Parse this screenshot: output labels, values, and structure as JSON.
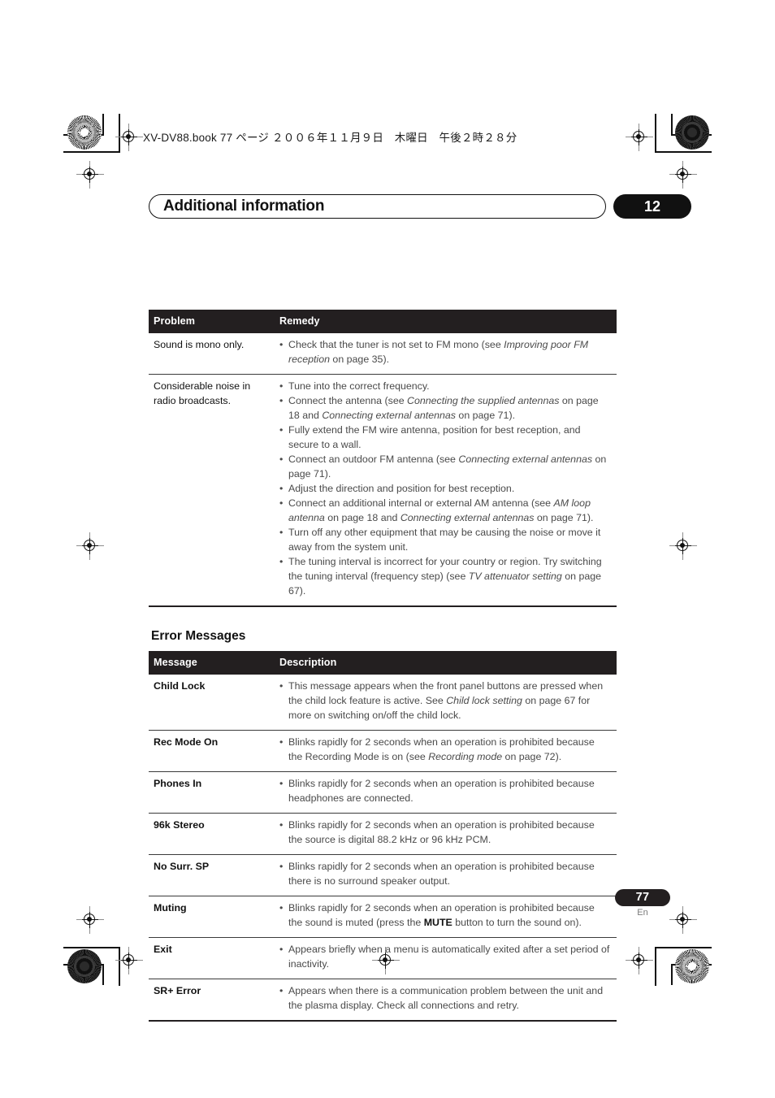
{
  "print_header": {
    "text": "XV-DV88.book  77 ページ  ２００６年１１月９日　木曜日　午後２時２８分"
  },
  "chapter": {
    "title": "Additional information",
    "number": "12"
  },
  "troubleshooting_table": {
    "headers": {
      "col1": "Problem",
      "col2": "Remedy"
    },
    "rows": [
      {
        "problem": "Sound is mono only.",
        "remedy_html": "<p>Check that the tuner is not set to FM mono (see <em>Improving poor FM reception</em> on page 35).</p>"
      },
      {
        "problem": "Considerable noise in radio broadcasts.",
        "remedy_html": "<p>Tune into the correct frequency.</p><p>Connect the antenna (see <em>Connecting the supplied antennas</em> on page 18 and <em>Connecting external antennas</em> on page 71).</p><p>Fully extend the FM wire antenna, position for best reception, and secure to a wall.</p><p>Connect an outdoor FM antenna (see <em>Connecting external antennas</em> on page 71).</p><p>Adjust the direction and position for best reception.</p><p>Connect an additional internal or external AM antenna (see <em>AM loop antenna</em> on page 18 and <em>Connecting external antennas</em> on page 71).</p><p>Turn off any other equipment that may be causing the noise or move it away from the system unit.</p><p>The tuning interval is incorrect for your country or region. Try switching the tuning interval (frequency step) (see <em>TV attenuator setting</em> on page 67).</p>"
      }
    ]
  },
  "error_messages_section": {
    "heading": "Error Messages",
    "headers": {
      "col1": "Message",
      "col2": "Description"
    },
    "rows": [
      {
        "message": "Child Lock",
        "description_html": "<p>This message appears when the front panel buttons are pressed when the child lock feature is active. See <em>Child lock setting</em> on page 67 for more on switching on/off the child lock.</p>"
      },
      {
        "message": "Rec Mode On",
        "description_html": "<p>Blinks rapidly for 2 seconds when an operation is prohibited because the Recording Mode is on (see <em>Recording mode</em> on page 72).</p>"
      },
      {
        "message": "Phones In",
        "description_html": "<p>Blinks rapidly for 2 seconds when an operation is prohibited because headphones are connected.</p>"
      },
      {
        "message": "96k Stereo",
        "description_html": "<p>Blinks rapidly for 2 seconds when an operation is prohibited because the source is digital 88.2 kHz  or 96 kHz PCM.</p>"
      },
      {
        "message": "No Surr. SP",
        "description_html": "<p>Blinks rapidly for 2 seconds when an operation is prohibited because there is no surround speaker output.</p>"
      },
      {
        "message": "Muting",
        "description_html": "<p>Blinks rapidly for 2 seconds when an operation is prohibited because the sound is muted (press the <strong>MUTE</strong> button to turn the sound on).</p>"
      },
      {
        "message": "Exit",
        "description_html": "<p>Appears briefly when a menu is automatically exited after a set period of inactivity.</p>"
      },
      {
        "message": "SR+ Error",
        "description_html": "<p>Appears when there is a communication problem between the unit and the plasma display. Check all connections and retry.</p>"
      }
    ]
  },
  "footer": {
    "page_number": "77",
    "language": "En"
  },
  "colors": {
    "header_bar": "#231f20",
    "text": "#4a4a4a",
    "key_text": "#111111"
  }
}
